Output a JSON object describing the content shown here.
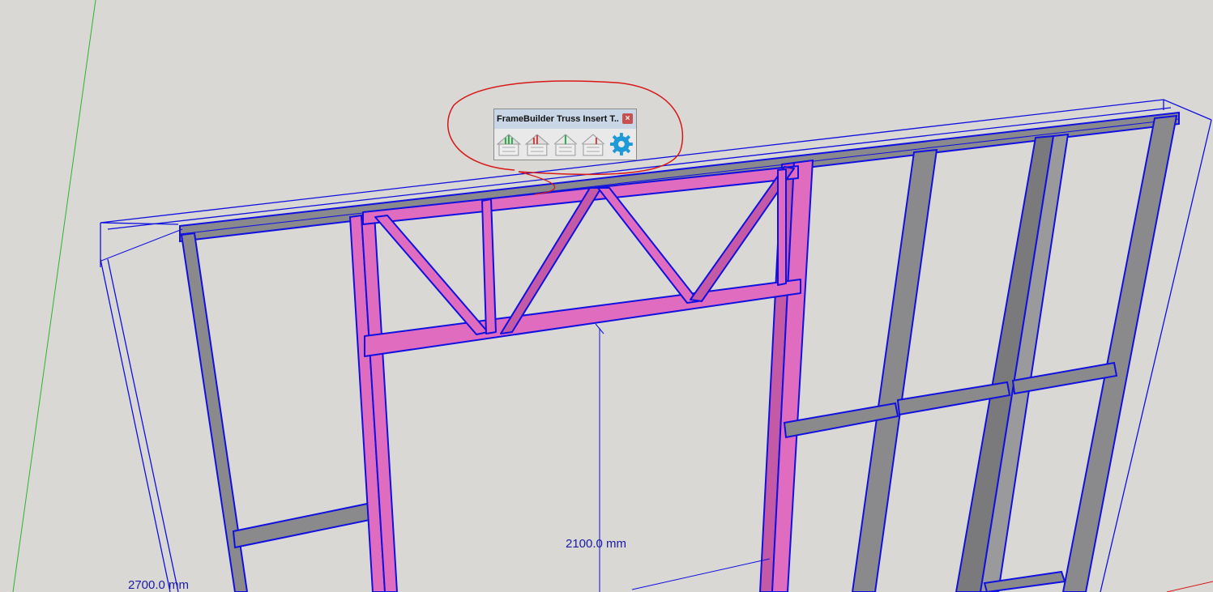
{
  "toolbar": {
    "title": "FrameBuilder Truss Insert T...",
    "close_glyph": "×",
    "tools": [
      {
        "name": "truss-green-icon",
        "accent": "#2aa84a"
      },
      {
        "name": "truss-red-icon",
        "accent": "#d23b3b"
      },
      {
        "name": "truss-green-open-icon",
        "accent": "#2aa84a"
      },
      {
        "name": "truss-red-open-icon",
        "accent": "#d23b3b"
      },
      {
        "name": "settings-gear-icon",
        "accent": "#1e9ad6"
      }
    ]
  },
  "dimensions": {
    "opening_height": "2100.0 mm",
    "wall_height": "2700.0 mm"
  },
  "colors": {
    "background": "#d9d8d4",
    "edge_blue": "#1010e0",
    "truss_pink": "#e06cc0",
    "stud_grey": "#8a8a8c",
    "annotation_red": "#d81818",
    "axis_green": "#2cb52c"
  }
}
